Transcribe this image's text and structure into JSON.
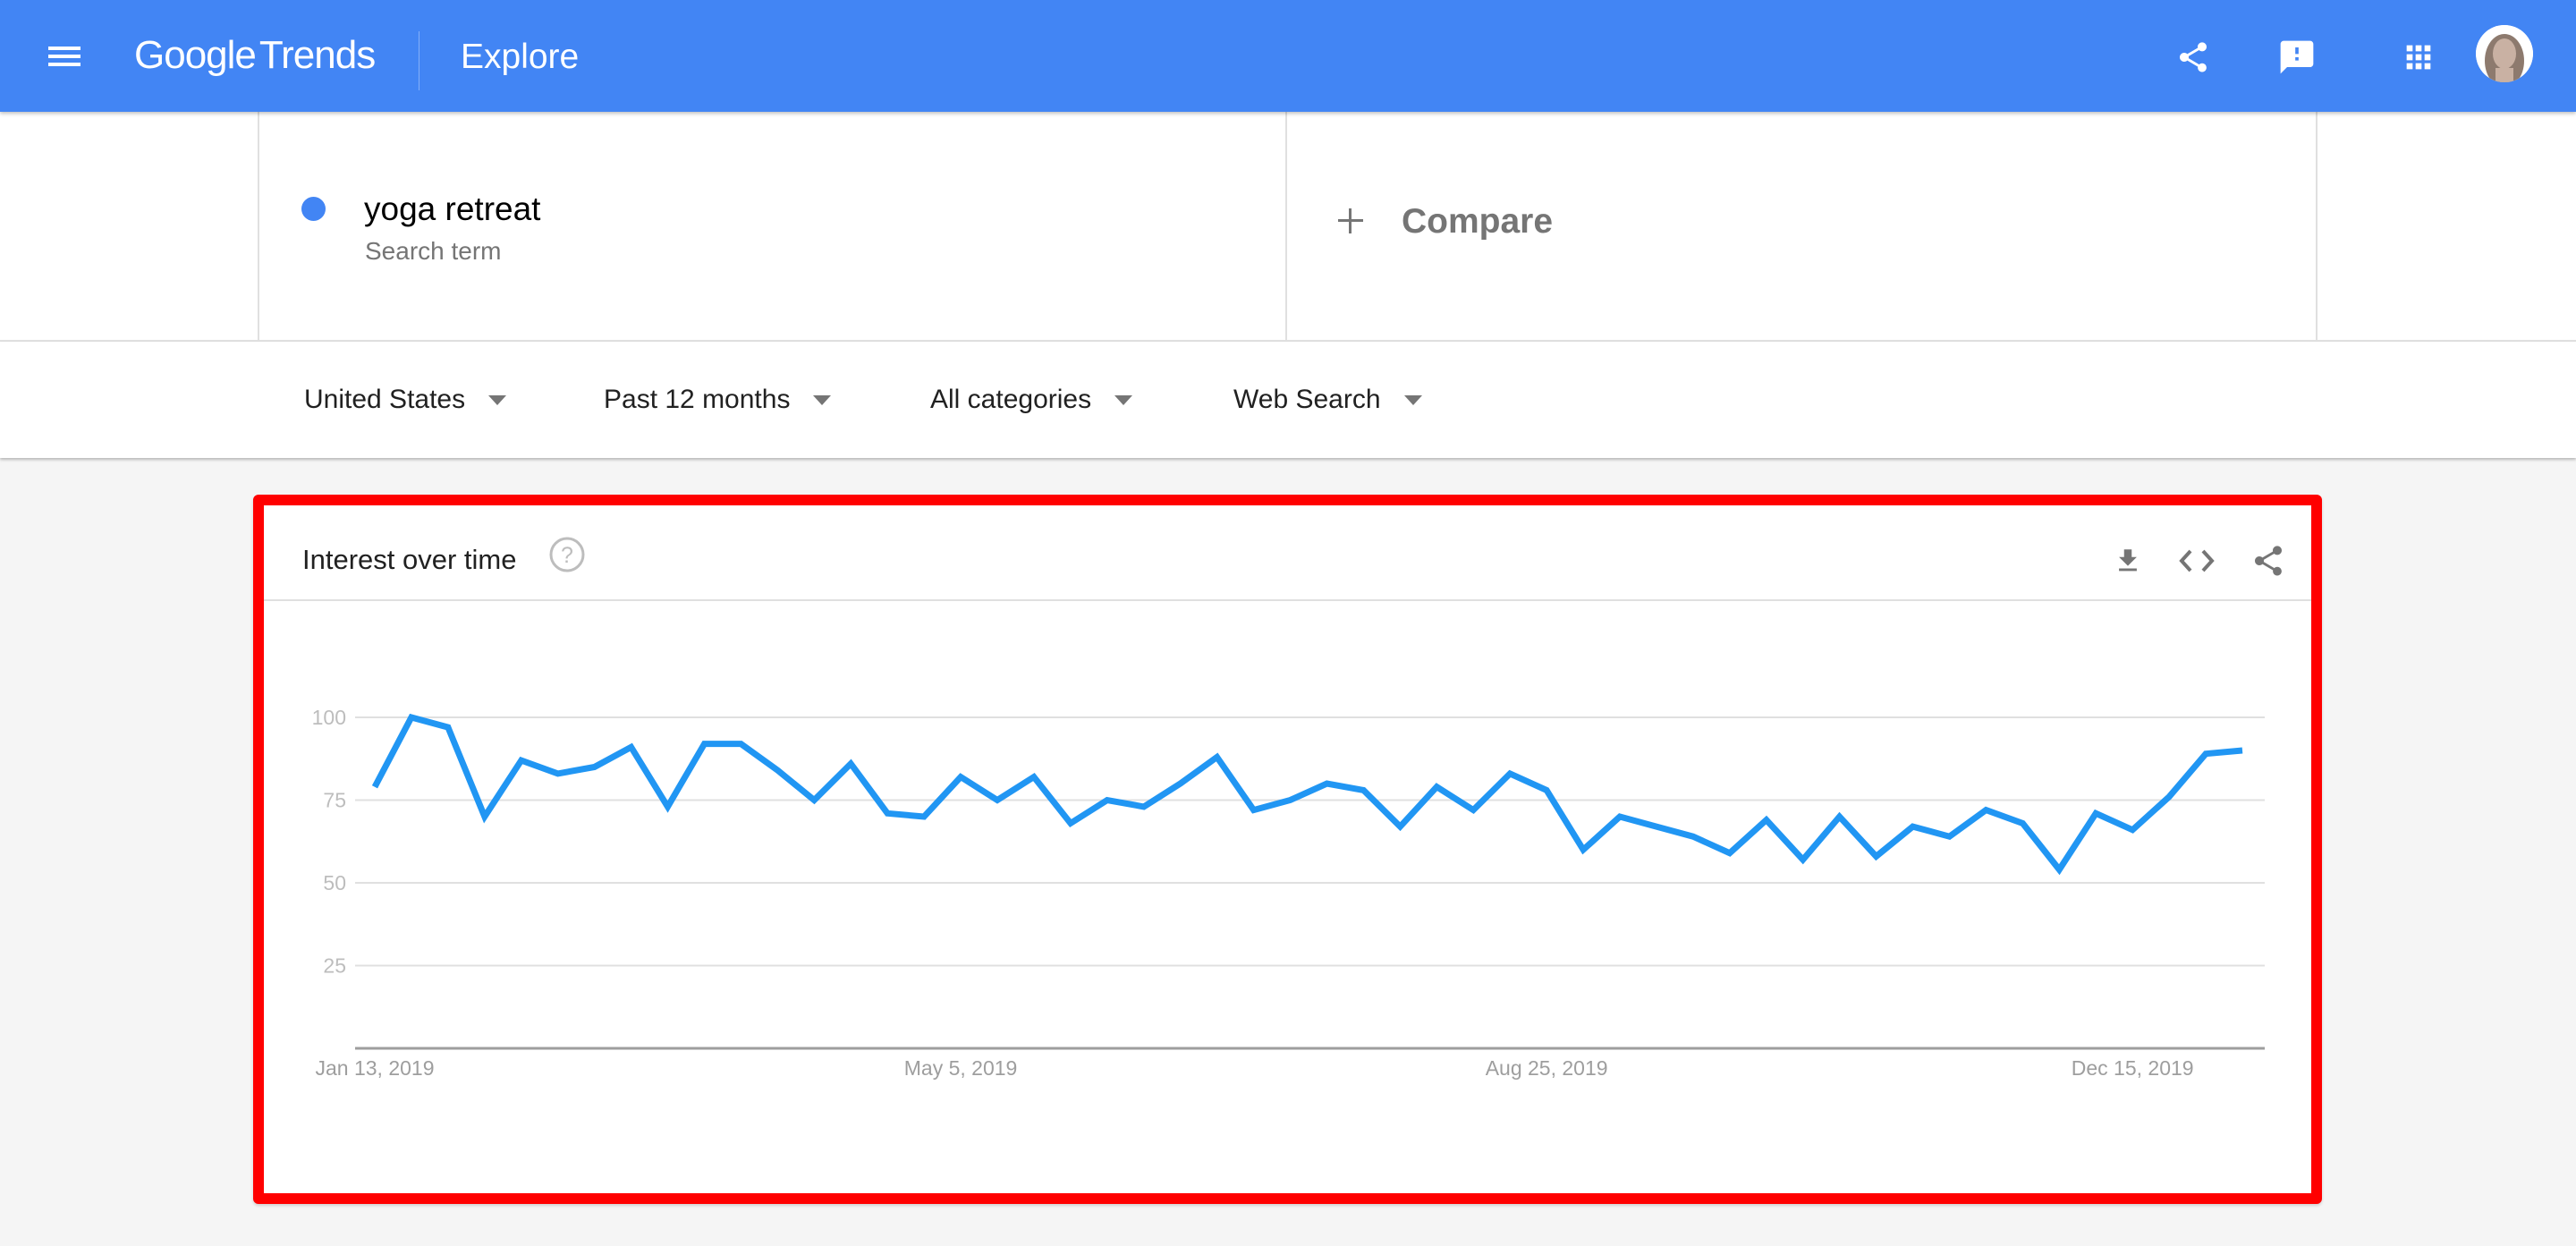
{
  "header": {
    "logo_google": "Google",
    "logo_trends": "Trends",
    "title": "Explore",
    "icons": [
      "menu-icon",
      "share-icon",
      "feedback-icon",
      "apps-icon",
      "account-avatar"
    ],
    "brand_color": "#4285f4"
  },
  "search": {
    "term": "yoga retreat",
    "term_type": "Search term",
    "term_color": "#4285f4",
    "compare_label": "Compare"
  },
  "filters": [
    {
      "label": "United States"
    },
    {
      "label": "Past 12 months"
    },
    {
      "label": "All categories"
    },
    {
      "label": "Web Search"
    }
  ],
  "card": {
    "title": "Interest over time",
    "actions": [
      "download-icon",
      "embed-code-icon",
      "share-icon"
    ],
    "highlight_color": "#ff0000"
  },
  "chart_data": {
    "type": "line",
    "title": "Interest over time",
    "xlabel": "",
    "ylabel": "",
    "ylim": [
      0,
      100
    ],
    "y_ticks": [
      25,
      50,
      75,
      100
    ],
    "x_tick_labels": [
      {
        "index": 0,
        "label": "Jan 13, 2019"
      },
      {
        "index": 16,
        "label": "May 5, 2019"
      },
      {
        "index": 32,
        "label": "Aug 25, 2019"
      },
      {
        "index": 48,
        "label": "Dec 15, 2019"
      }
    ],
    "grid": true,
    "legend": "none",
    "series": [
      {
        "name": "yoga retreat",
        "color": "#2196f3",
        "values": [
          79,
          100,
          97,
          70,
          87,
          83,
          85,
          91,
          73,
          92,
          92,
          84,
          75,
          86,
          71,
          70,
          82,
          75,
          82,
          68,
          75,
          73,
          80,
          88,
          72,
          75,
          80,
          78,
          67,
          79,
          72,
          83,
          78,
          60,
          70,
          67,
          64,
          59,
          69,
          57,
          70,
          58,
          67,
          64,
          72,
          68,
          54,
          71,
          66,
          76,
          89,
          90
        ]
      }
    ]
  }
}
